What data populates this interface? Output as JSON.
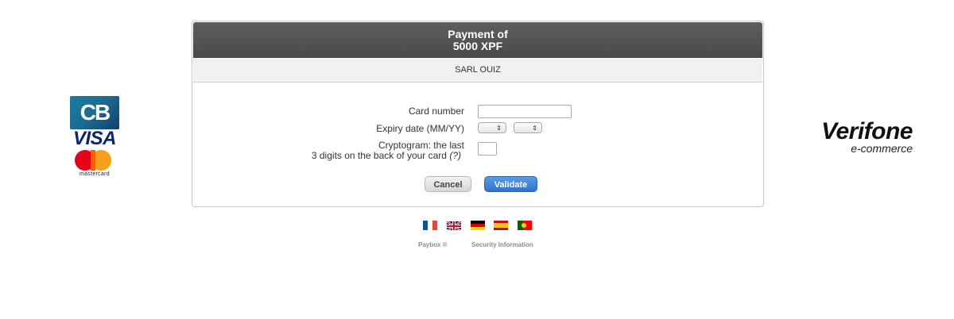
{
  "header": {
    "line1": "Payment of",
    "line2": "5000 XPF"
  },
  "merchant": {
    "name": "SARL OUIZ"
  },
  "form": {
    "card_number_label": "Card number",
    "card_number_value": "",
    "expiry_label": "Expiry date (MM/YY)",
    "month_value": "",
    "year_value": "",
    "cryptogram_label_line1": "Cryptogram: the last",
    "cryptogram_label_line2": "3 digits on the back of your card",
    "cryptogram_help": "(?)",
    "cryptogram_value": ""
  },
  "buttons": {
    "cancel": "Cancel",
    "validate": "Validate"
  },
  "logos": {
    "cb": "CB",
    "visa": "VISA",
    "mastercard": "mastercard",
    "verifone_brand": "Verifone",
    "verifone_sub": "e-commerce"
  },
  "languages": [
    "fr-flag-icon",
    "uk-flag-icon",
    "de-flag-icon",
    "es-flag-icon",
    "pt-flag-icon"
  ],
  "footer": {
    "paybox": "Paybox ®",
    "security": "Security Information"
  },
  "colors": {
    "header_bg": "#4f4f4f",
    "validate_bg": "#3a7ed9",
    "merchant_bg": "#f1f1f1"
  }
}
